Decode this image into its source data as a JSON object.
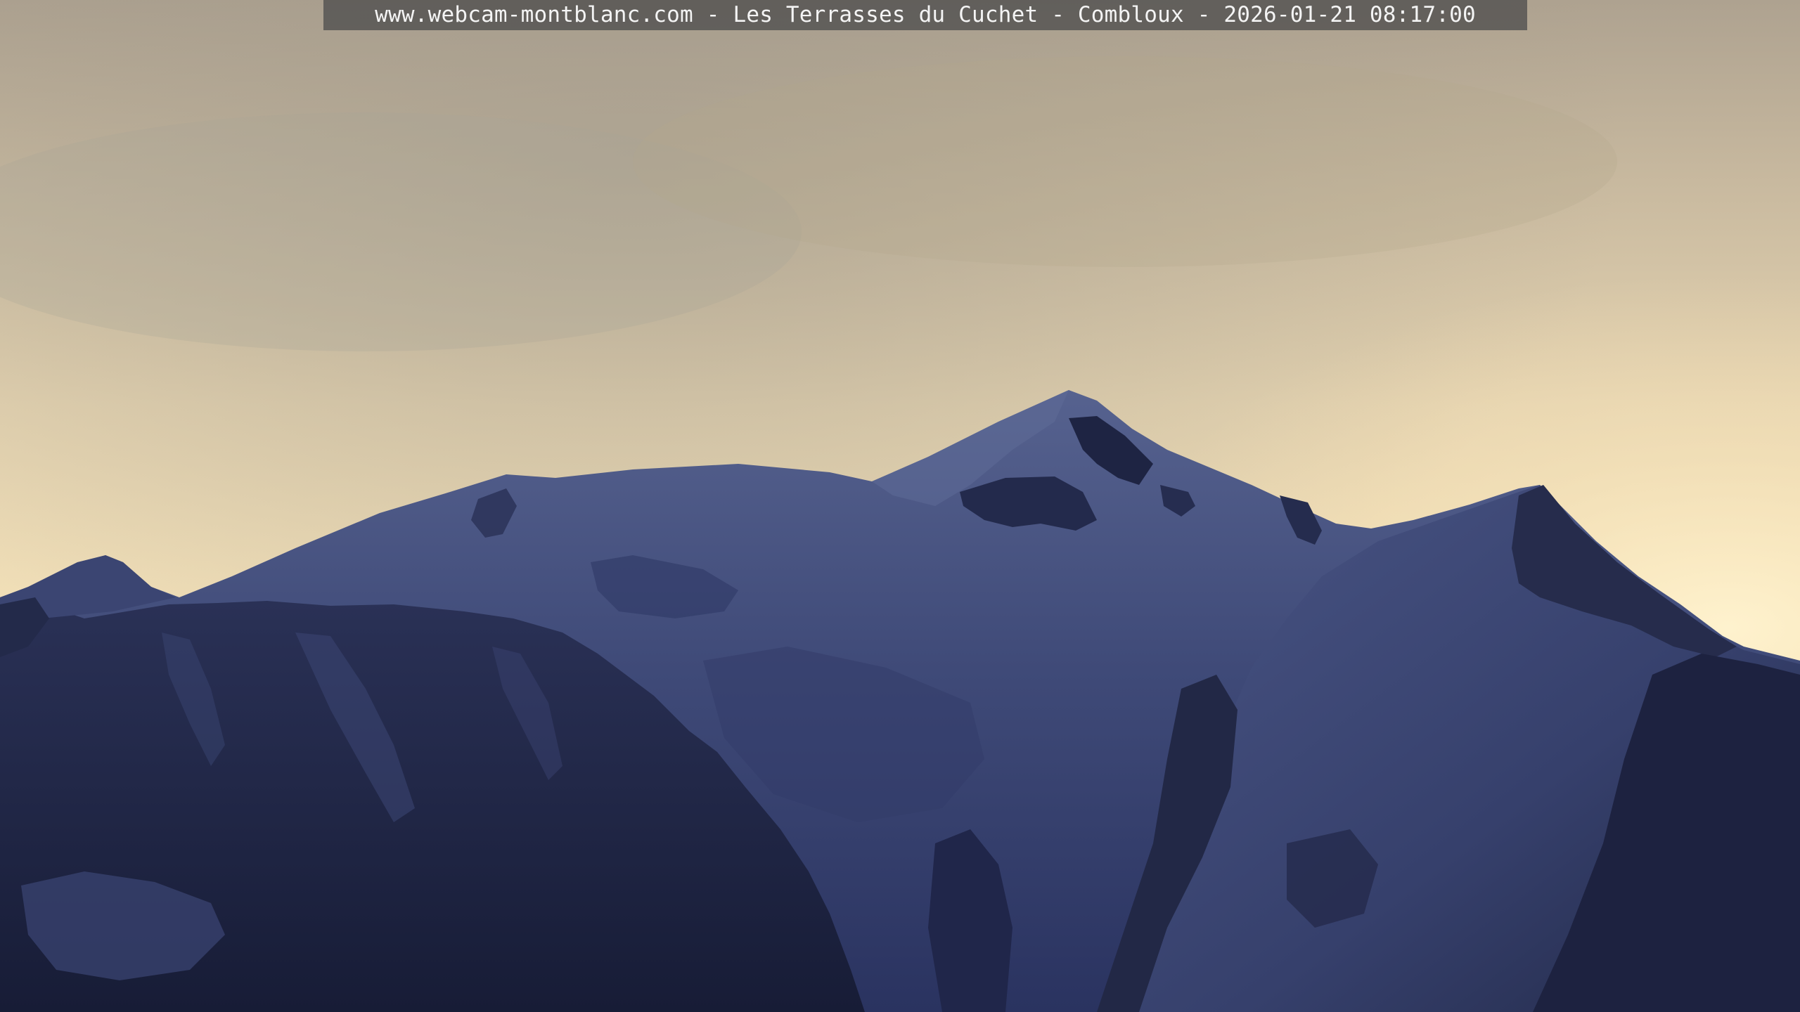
{
  "image": {
    "description_free_caption": "www.webcam-montblanc.com - Les Terrasses du Cuchet - Combloux - 2026-01-21 08:17:00"
  },
  "colors": {
    "sky_top": "#b9ad9a",
    "sky_mid": "#e3d2b0",
    "sky_glow": "#fbe8bf",
    "snow_light": "#4d5a86",
    "snow_mid": "#3c4774",
    "snow_dark": "#2c3560",
    "rock_dark": "#1c2240",
    "caption_bg": "#464648",
    "caption_text": "#f4f4f4"
  }
}
